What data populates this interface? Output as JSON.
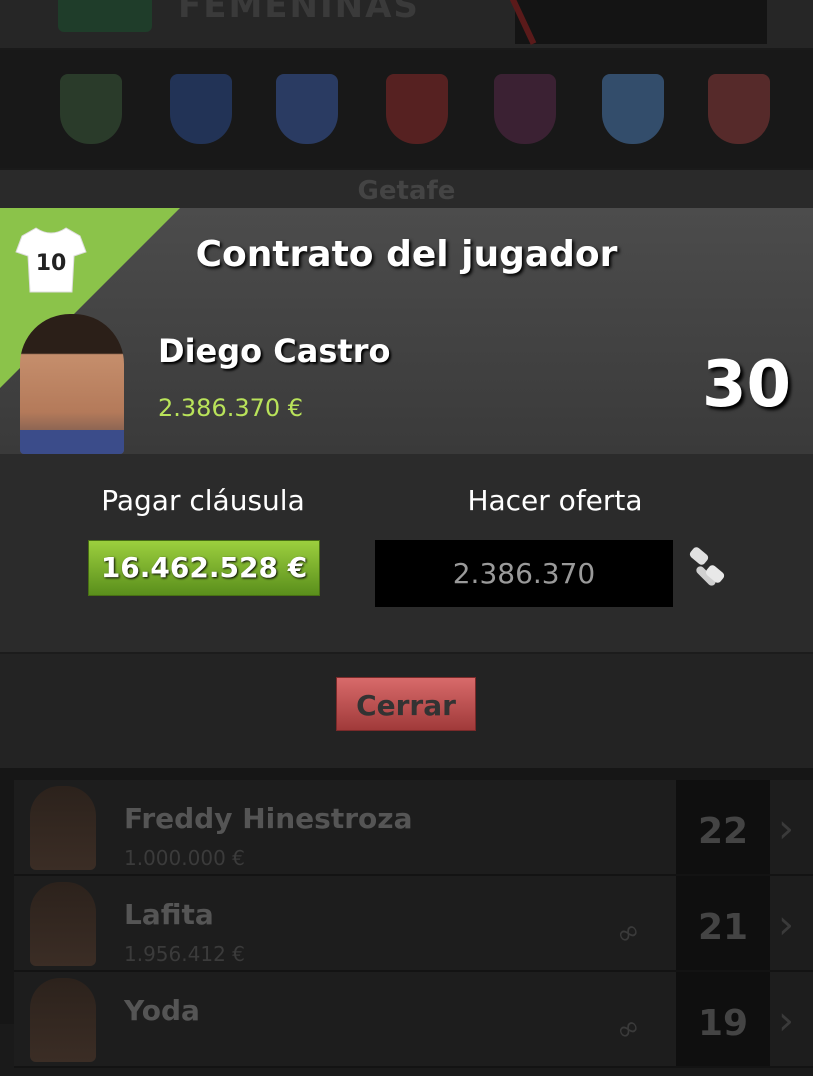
{
  "background": {
    "banner_text": "FEMENINAS",
    "team_label": "Getafe",
    "crests": [
      {
        "icon": "elche-crest-icon",
        "color": "#3b5a3b"
      },
      {
        "icon": "espanyol-crest-icon",
        "color": "#2b4a8a"
      },
      {
        "icon": "getafe-crest-icon",
        "color": "#3a5aa0"
      },
      {
        "icon": "granada-crest-icon",
        "color": "#8a2a2a"
      },
      {
        "icon": "levante-crest-icon",
        "color": "#5a2a4a"
      },
      {
        "icon": "malaga-crest-icon",
        "color": "#4a7ab0"
      },
      {
        "icon": "rayo-crest-icon",
        "color": "#8a3a3a"
      }
    ],
    "players": [
      {
        "name": "Freddy Hinestroza",
        "value": "1.000.000 €",
        "number": "22",
        "linked": false
      },
      {
        "name": "Lafita",
        "value": "1.956.412 €",
        "number": "21",
        "linked": true
      },
      {
        "name": "Yoda",
        "value": "",
        "number": "19",
        "linked": true
      }
    ]
  },
  "modal": {
    "title": "Contrato del jugador",
    "shirt_number": "10",
    "player": {
      "name": "Diego Castro",
      "price": "2.386.370 €",
      "number": "30"
    },
    "clause_label": "Pagar cláusula",
    "clause_value": "16.462.528 €",
    "offer_label": "Hacer oferta",
    "offer_value": "2.386.370",
    "close_label": "Cerrar"
  },
  "colors": {
    "accent_green": "#8bc34a",
    "price_green": "#b9e35a",
    "close_red": "#c05050"
  }
}
